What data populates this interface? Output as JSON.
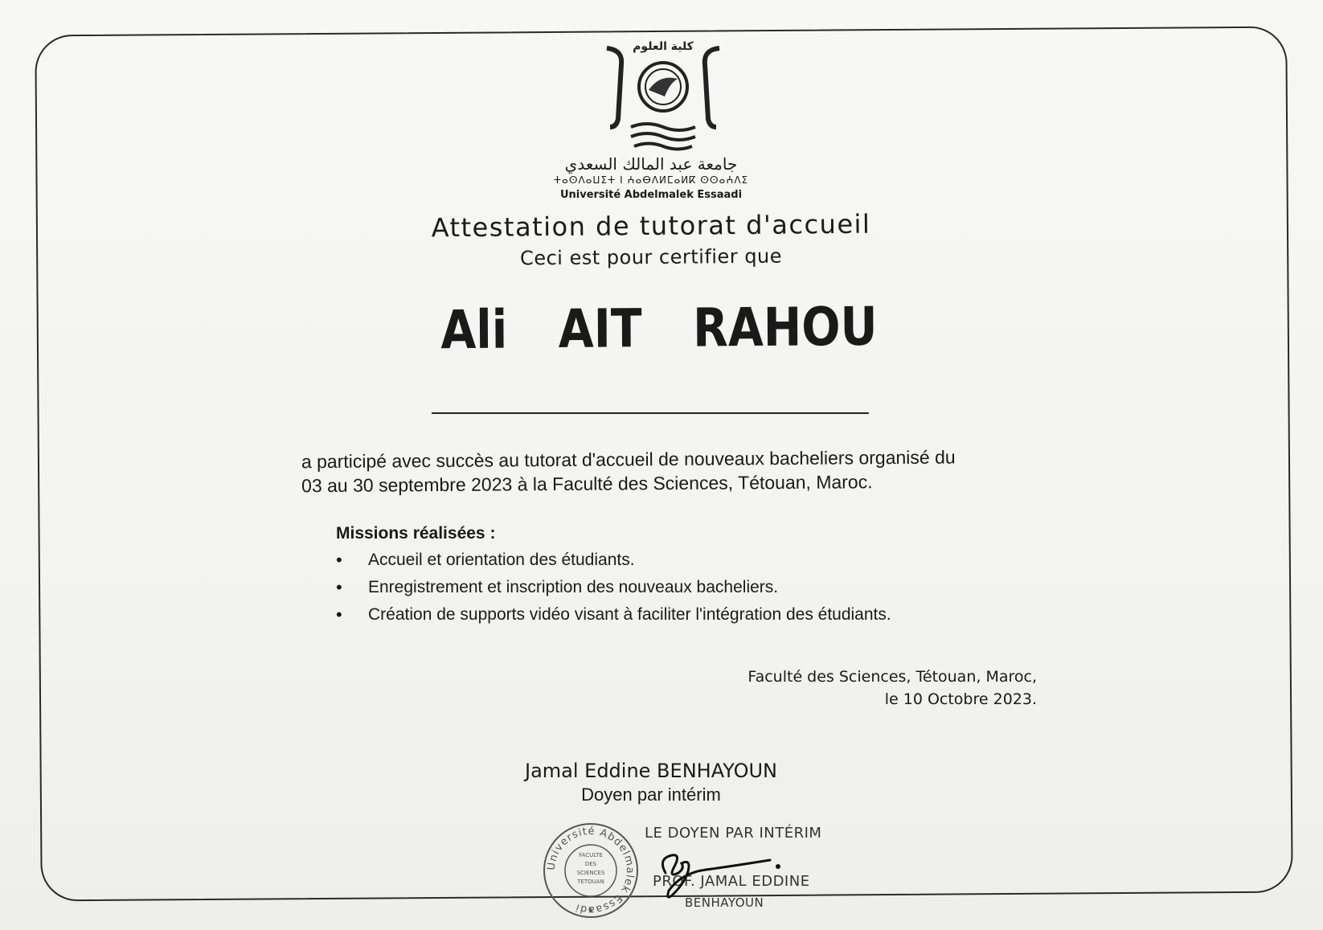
{
  "university": {
    "faculty_ar": "كلية العلوم",
    "name_ar": "جامعة عبد المالك السعدي",
    "name_tifinagh": "ⵜⴰⵙⴷⴰⵡⵉⵜ ⵏ ⵄⴰⴱⴷⵍⵎⴰⵍⴽ ⵙⵙⴰⵄⴷⵉ",
    "name_fr": "Université Abdelmalek Essaadi"
  },
  "certificate": {
    "title": "Attestation de tutorat d'accueil",
    "subtitle": "Ceci est pour certifier que",
    "recipient_name": "Ali  AIT  RAHOU",
    "paragraph_line1": "a participé avec succès au tutorat d'accueil de nouveaux bacheliers organisé du",
    "paragraph_line2": "03 au 30 septembre 2023 à la Faculté des Sciences, Tétouan, Maroc.",
    "missions_title": "Missions réalisées :",
    "missions": [
      "Accueil et orientation des étudiants.",
      "Enregistrement et inscription des nouveaux bacheliers.",
      "Création de supports vidéo visant à faciliter l'intégration des étudiants."
    ],
    "place_line1": "Faculté des Sciences, Tétouan, Maroc,",
    "place_line2": "le 10 Octobre 2023.",
    "signer_name": "Jamal Eddine BENHAYOUN",
    "signer_role": "Doyen par intérim"
  },
  "stamp": {
    "outer_text": "Université Abdelmalek Essaadi",
    "inner_line1": "FACULTE",
    "inner_line2": "DES",
    "inner_line3": "SCIENCES",
    "inner_line4": "TETOUAN",
    "header": "LE DOYEN PAR INTÉRIM",
    "line1": "PROF. JAMAL EDDINE",
    "line2": "BENHAYOUN"
  },
  "bullet_symbol": "•"
}
